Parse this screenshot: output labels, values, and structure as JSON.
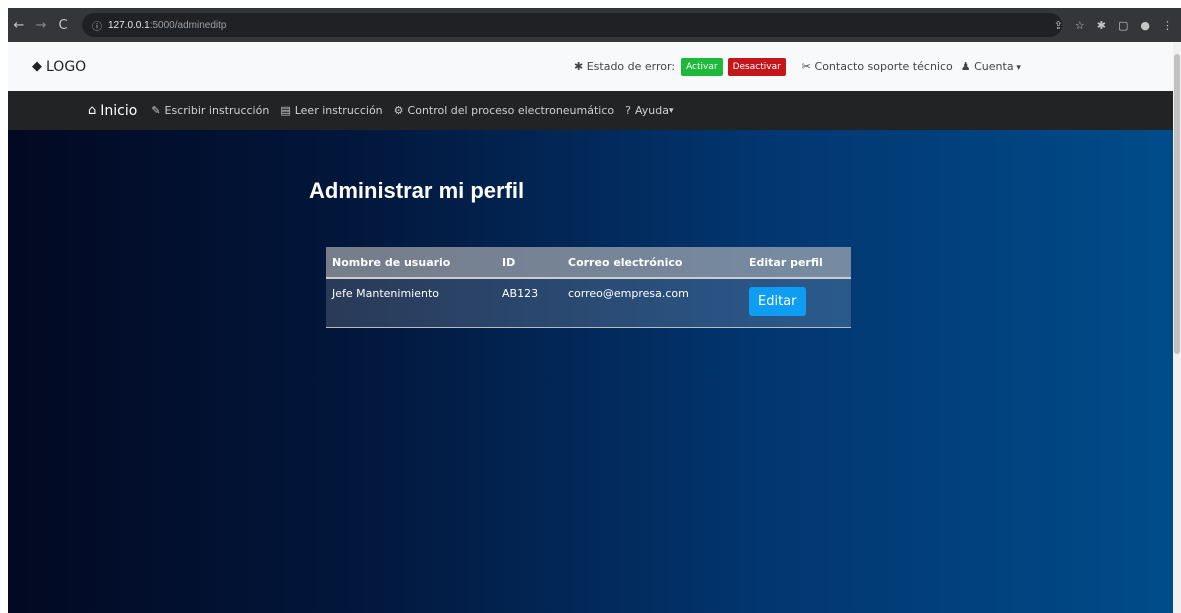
{
  "browser": {
    "url_host": "127.0.0.1",
    "url_path": ":5000/admineditp"
  },
  "topbar": {
    "brand": "LOGO",
    "error_state_label": "Estado de error:",
    "activate_label": "Activar",
    "deactivate_label": "Desactivar",
    "support_label": "Contacto soporte técnico",
    "account_label": "Cuenta"
  },
  "navbar": {
    "home": "Inicio",
    "write": "Escribir instrucción",
    "read": "Leer instrucción",
    "control": "Control del proceso electroneumático",
    "help": "Ayuda"
  },
  "main": {
    "title": "Administrar mi perfil",
    "table": {
      "headers": [
        "Nombre de usuario",
        "ID",
        "Correo electrónico",
        "Editar perfil"
      ],
      "rows": [
        {
          "name": "Jefe Mantenimiento",
          "id": "AB123",
          "email": "correo@empresa.com",
          "action": "Editar"
        }
      ]
    }
  },
  "colors": {
    "activate": "#1eb83a",
    "deactivate": "#c4171b",
    "edit_button": "#0d9df2"
  }
}
